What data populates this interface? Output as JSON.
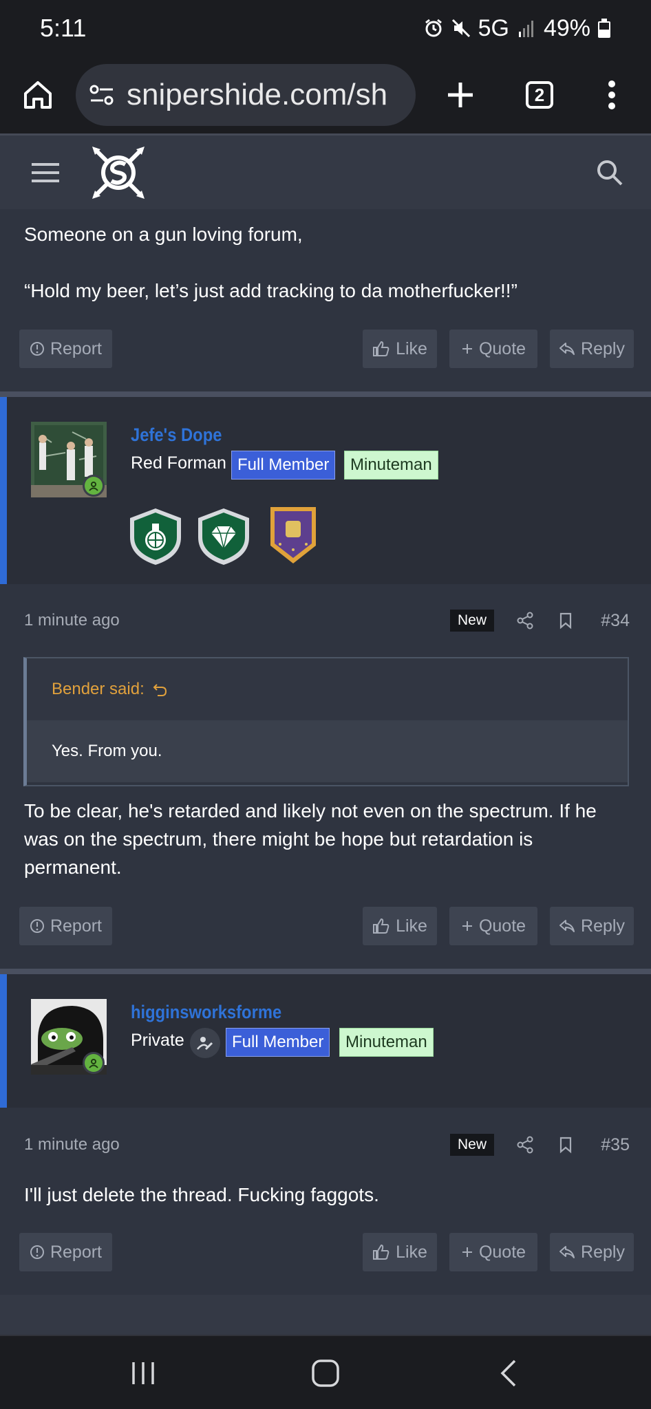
{
  "status_bar": {
    "time": "5:11",
    "network": "5G",
    "battery": "49%",
    "icons": [
      "alarm-icon",
      "mute-icon",
      "signal-icon",
      "battery-icon"
    ]
  },
  "browser": {
    "url": "snipershide.com/sh",
    "tab_count": "2"
  },
  "posts": [
    {
      "lines": [
        "Someone on a gun loving forum,",
        "",
        "“Hold my beer, let’s just add tracking to da motherfucker!!”"
      ],
      "actions": {
        "report": "Report",
        "like": "Like",
        "quote": "Quote",
        "reply": "Reply"
      }
    },
    {
      "author": "Jefe's Dope",
      "user_title": "Red Forman",
      "banners": [
        "Full Member",
        "Minuteman"
      ],
      "time": "1 minute ago",
      "new_label": "New",
      "number": "#34",
      "quote": {
        "attribution": "Bender said:",
        "text": "Yes. From you."
      },
      "text": "To be clear, he's retarded and likely not even on the spectrum. If he was on the spectrum, there might be hope but retardation is permanent.",
      "actions": {
        "report": "Report",
        "like": "Like",
        "quote": "Quote",
        "reply": "Reply"
      }
    },
    {
      "author": "higginsworksforme",
      "user_title": "Private",
      "banners": [
        "Full Member",
        "Minuteman"
      ],
      "time": "1 minute ago",
      "new_label": "New",
      "number": "#35",
      "text": "I'll just delete the thread. Fucking faggots.",
      "actions": {
        "report": "Report",
        "like": "Like",
        "quote": "Quote",
        "reply": "Reply"
      }
    }
  ],
  "colors": {
    "accent": "#2f73d8",
    "background": "#2f3440",
    "banner_blue": "#3b5fd8",
    "banner_green": "#cdf7cf",
    "quote_attribution": "#e1a13c"
  }
}
